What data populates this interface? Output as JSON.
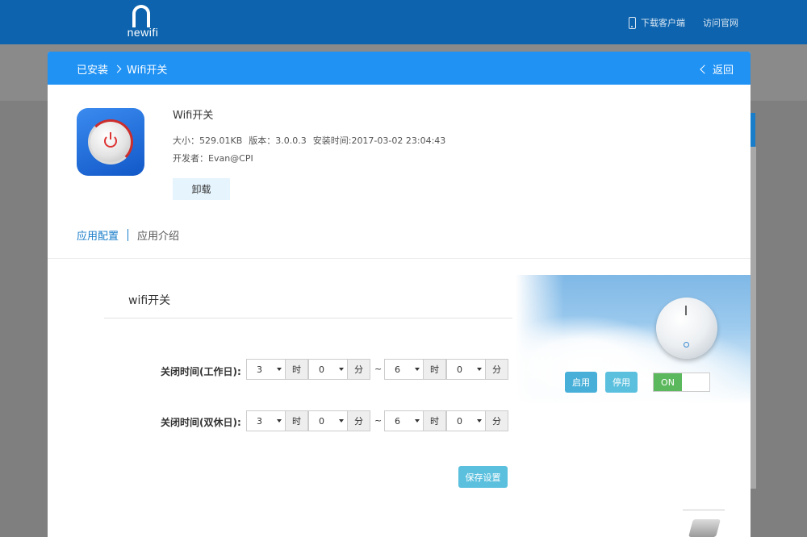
{
  "header": {
    "logo_text": "newifi",
    "links": [
      "下载客户端",
      "访问官网"
    ]
  },
  "modal": {
    "breadcrumb": [
      "已安装",
      "Wifi开关"
    ],
    "back_label": "返回"
  },
  "app": {
    "name": "Wifi开关",
    "size": "大小：529.01KB",
    "version": "版本：3.0.0.3",
    "installed": "安装时间:2017-03-02 23:04:43",
    "developer": "开发者：Evan@CPI",
    "uninstall_label": "卸载"
  },
  "tabs": {
    "config": "应用配置",
    "intro": "应用介绍"
  },
  "config": {
    "title": "wifi开关",
    "rows": [
      {
        "label": "关闭时间(工作日):",
        "start_hour": "3",
        "start_min": "0",
        "end_hour": "6",
        "end_min": "0"
      },
      {
        "label": "关闭时间(双休日):",
        "start_hour": "3",
        "start_min": "0",
        "end_hour": "6",
        "end_min": "0"
      }
    ],
    "hour_unit": "时",
    "min_unit": "分",
    "range_sep": "~",
    "enable_label": "启用",
    "disable_label": "停用",
    "toggle_label": "ON",
    "save_label": "保存设置"
  },
  "colors": {
    "header_bg": "#0d63ad",
    "modal_header_bg": "#1f92f4",
    "accent": "#1a7dc9",
    "toggle_on": "#5cb85c",
    "button_info": "#5bc0de"
  }
}
